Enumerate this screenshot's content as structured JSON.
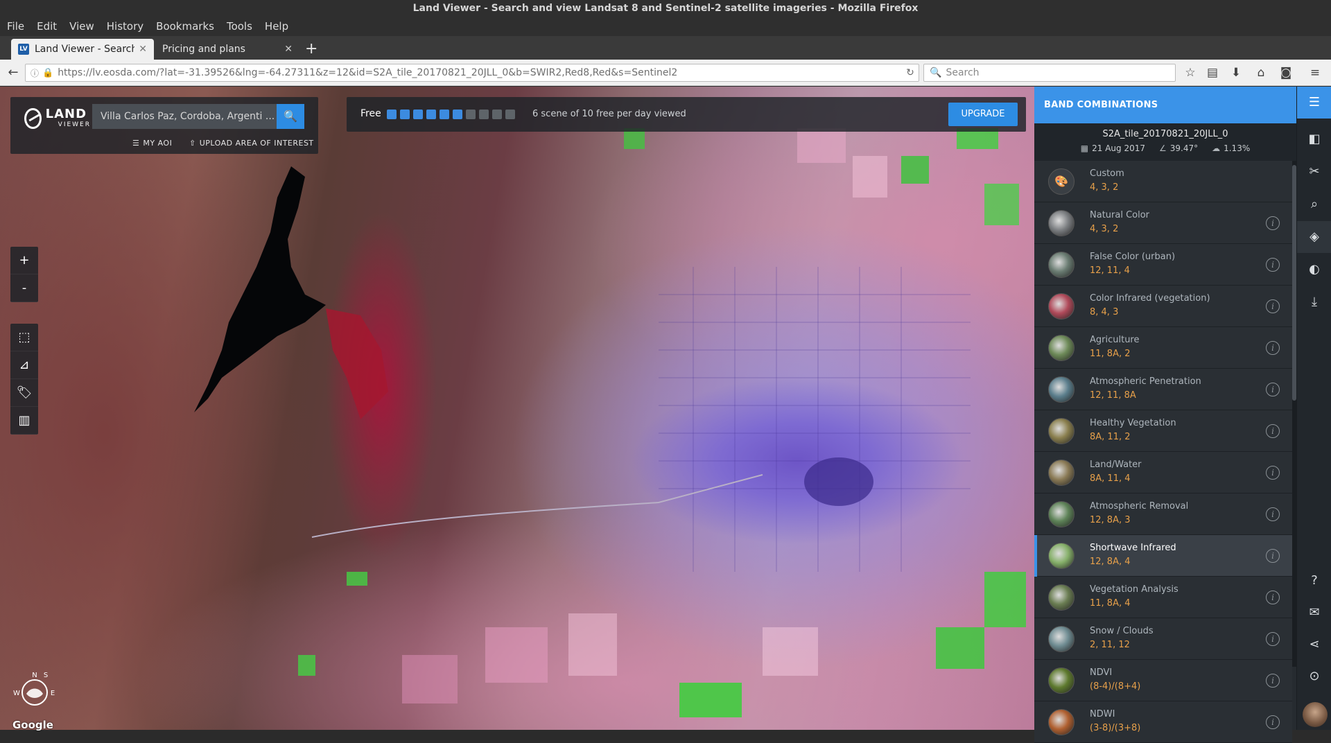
{
  "window": {
    "title": "Land Viewer - Search and view Landsat 8 and Sentinel-2 satellite imageries - Mozilla Firefox"
  },
  "menu": [
    "File",
    "Edit",
    "View",
    "History",
    "Bookmarks",
    "Tools",
    "Help"
  ],
  "tabs": [
    {
      "title": "Land Viewer - Search and",
      "favicon": "LV",
      "active": true
    },
    {
      "title": "Pricing and plans",
      "active": false
    }
  ],
  "nav": {
    "url": "https://lv.eosda.com/?lat=-31.39526&lng=-64.27311&z=12&id=S2A_tile_20170821_20JLL_0&b=SWIR2,Red8,Red&s=Sentinel2",
    "search_placeholder": "Search"
  },
  "app": {
    "logo_word1": "LAND",
    "logo_word2": "VIEWER",
    "search_value": "Villa Carlos Paz, Cordoba, Argenti ...",
    "my_aoi": "MY AOI",
    "upload_aoi": "UPLOAD AREA OF INTEREST",
    "free_label": "Free",
    "quota_used": 6,
    "quota_total": 10,
    "quota_text": "6 scene of 10 free per day viewed",
    "upgrade_label": "UPGRADE",
    "zoom_in": "+",
    "zoom_out": "-",
    "compass_letters": {
      "n": "N",
      "e": "E",
      "s": "S",
      "w": "W"
    },
    "google": "Google"
  },
  "panel": {
    "header": "BAND COMBINATIONS",
    "scene_id": "S2A_tile_20170821_20JLL_0",
    "scene_date": "21 Aug 2017",
    "scene_angle": "39.47°",
    "scene_cloud": "1.13%",
    "bands": [
      {
        "name": "Custom",
        "bands": "4, 3, 2",
        "thumb": "#3a3f44",
        "info": false
      },
      {
        "name": "Natural Color",
        "bands": "4, 3, 2",
        "thumb": "#7c7f82",
        "info": true
      },
      {
        "name": "False Color (urban)",
        "bands": "12, 11, 4",
        "thumb": "#6a7c72",
        "info": true
      },
      {
        "name": "Color Infrared (vegetation)",
        "bands": "8, 4, 3",
        "thumb": "#b04a5a",
        "info": true
      },
      {
        "name": "Agriculture",
        "bands": "11, 8A, 2",
        "thumb": "#6d8a58",
        "info": true
      },
      {
        "name": "Atmospheric Penetration",
        "bands": "12, 11, 8A",
        "thumb": "#5b7e8c",
        "info": true
      },
      {
        "name": "Healthy Vegetation",
        "bands": "8A, 11, 2",
        "thumb": "#8a7f4e",
        "info": true
      },
      {
        "name": "Land/Water",
        "bands": "8A, 11, 4",
        "thumb": "#8a7a55",
        "info": true
      },
      {
        "name": "Atmospheric Removal",
        "bands": "12, 8A, 3",
        "thumb": "#5e8358",
        "info": true
      },
      {
        "name": "Shortwave Infrared",
        "bands": "12, 8A, 4",
        "thumb": "#86b06a",
        "info": true,
        "active": true
      },
      {
        "name": "Vegetation Analysis",
        "bands": "11, 8A, 4",
        "thumb": "#6a7d52",
        "info": true
      },
      {
        "name": "Snow / Clouds",
        "bands": "2, 11, 12",
        "thumb": "#6f8c92",
        "info": true
      },
      {
        "name": "NDVI",
        "bands": "(8-4)/(8+4)",
        "thumb": "#5e7a2e",
        "info": true
      },
      {
        "name": "NDWI",
        "bands": "(3-8)/(3+8)",
        "thumb": "#b06030",
        "info": true
      }
    ]
  },
  "icons": {
    "sidebar": [
      "list-icon",
      "compare-icon",
      "tools-icon",
      "search-icon",
      "layers-icon",
      "contrast-icon",
      "download-icon",
      "help-icon",
      "chat-icon",
      "share-icon",
      "download-circle-icon"
    ]
  }
}
